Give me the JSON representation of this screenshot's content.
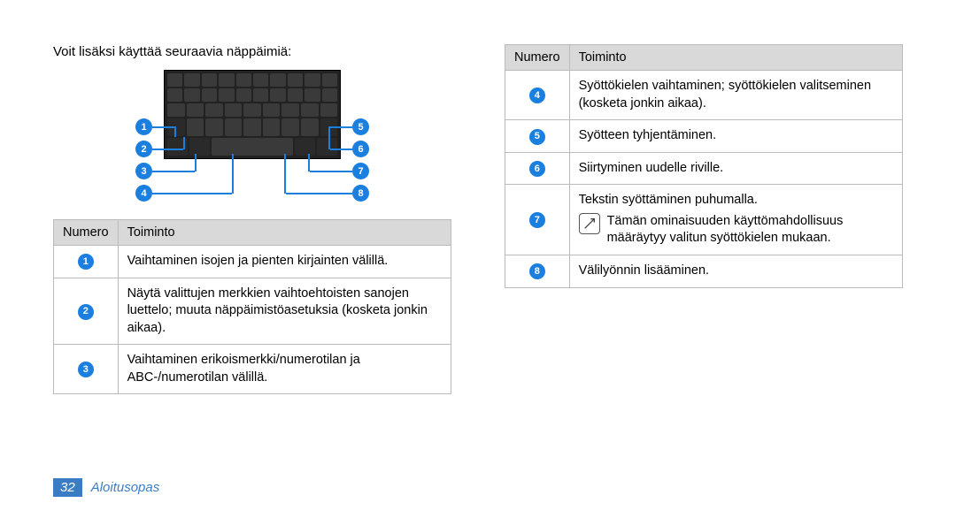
{
  "intro": "Voit lisäksi käyttää seuraavia näppäimiä:",
  "bubbles": {
    "b1": "1",
    "b2": "2",
    "b3": "3",
    "b4": "4",
    "b5": "5",
    "b6": "6",
    "b7": "7",
    "b8": "8"
  },
  "table_left": {
    "h1": "Numero",
    "h2": "Toiminto",
    "r1": "Vaihtaminen isojen ja pienten kirjainten välillä.",
    "r2": "Näytä valittujen merkkien vaihtoehtoisten sanojen luettelo; muuta näppäimistöasetuksia (kosketa jonkin aikaa).",
    "r3": "Vaihtaminen erikoismerkki/numerotilan ja ABC-/numerotilan välillä."
  },
  "table_right": {
    "h1": "Numero",
    "h2": "Toiminto",
    "r4": "Syöttökielen vaihtaminen; syöttökielen valitseminen (kosketa jonkin aikaa).",
    "r5": "Syötteen tyhjentäminen.",
    "r6": "Siirtyminen uudelle riville.",
    "r7a": "Tekstin syöttäminen puhumalla.",
    "r7b": "Tämän ominaisuuden käyttömahdollisuus määräytyy valitun syöttökielen mukaan.",
    "r8": "Välilyönnin lisääminen."
  },
  "footer": {
    "page": "32",
    "section": "Aloitusopas"
  }
}
